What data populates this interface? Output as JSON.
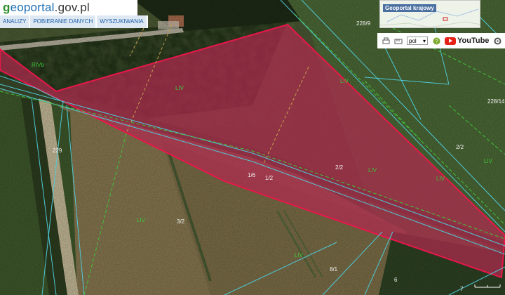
{
  "site": {
    "brand_g": "g",
    "brand_name": "eoportal",
    "brand_domain": ".gov.pl"
  },
  "menu": [
    {
      "label": "ANALIZY"
    },
    {
      "label": "POBIERANIE DANYCH"
    },
    {
      "label": "WYSZUKIWANIA"
    }
  ],
  "overview": {
    "title": "Geoportal krajowy"
  },
  "toolbar": {
    "language": "pol",
    "youtube": "YouTube",
    "icons": [
      "print-icon",
      "measure-icon",
      "help-icon",
      "settings-icon"
    ]
  },
  "parcels": {
    "main_number": "2/2",
    "labels": [
      "228/9",
      "228/14",
      "2/2",
      "229",
      "1/2",
      "3/2",
      "8/1",
      "6",
      "7",
      "1/6"
    ],
    "land_class_labels": [
      "RIVb",
      "LIV",
      "LIV",
      "LIV",
      "LIV",
      "LIV",
      "LIV",
      "LIV"
    ]
  },
  "colors": {
    "parcel_fill": "#b0294f",
    "parcel_outline": "#e8174a",
    "boundary_cyan": "#4fc9d6",
    "class_green": "#40c23a",
    "label_white": "#f2f2f2",
    "label_cyan": "#a6f0ff"
  }
}
